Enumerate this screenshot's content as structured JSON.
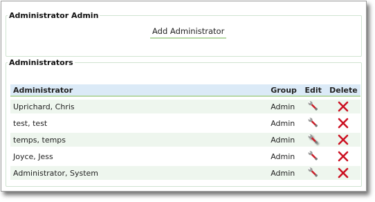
{
  "admin_section": {
    "legend": "Administrator Admin",
    "add_button_label": "Add Administrator"
  },
  "list_section": {
    "legend": "Administrators",
    "columns": {
      "administrator": "Administrator",
      "group": "Group",
      "edit": "Edit",
      "delete": "Delete"
    },
    "rows": [
      {
        "name": "Uprichard, Chris",
        "group": "Admin"
      },
      {
        "name": "test, test",
        "group": "Admin"
      },
      {
        "name": "temps, temps",
        "group": "Admin"
      },
      {
        "name": "Joyce, Jess",
        "group": "Admin"
      },
      {
        "name": "Administrator, System",
        "group": "Admin"
      }
    ],
    "edit_icon": "wrench-icon",
    "delete_icon": "red-x-icon"
  },
  "colors": {
    "header_bg": "#dbeaf7",
    "underline_green": "#b6d8a5",
    "stripe": "#eef6ee",
    "delete_red": "#cc1122"
  }
}
